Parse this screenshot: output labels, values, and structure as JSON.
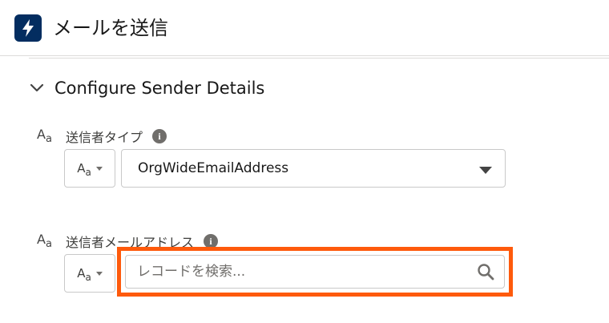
{
  "header": {
    "title": "メールを送信",
    "icon": "lightning-bolt-icon",
    "icon_bg": "#032d60"
  },
  "section": {
    "title": "Configure Sender Details",
    "expanded": true
  },
  "fields": [
    {
      "label": "送信者タイプ",
      "type_toggle": "Aa",
      "value": "OrgWideEmailAddress"
    },
    {
      "label": "送信者メールアドレス",
      "type_toggle": "Aa",
      "placeholder": "レコードを検索..."
    }
  ],
  "highlight_color": "#fe5a0c"
}
